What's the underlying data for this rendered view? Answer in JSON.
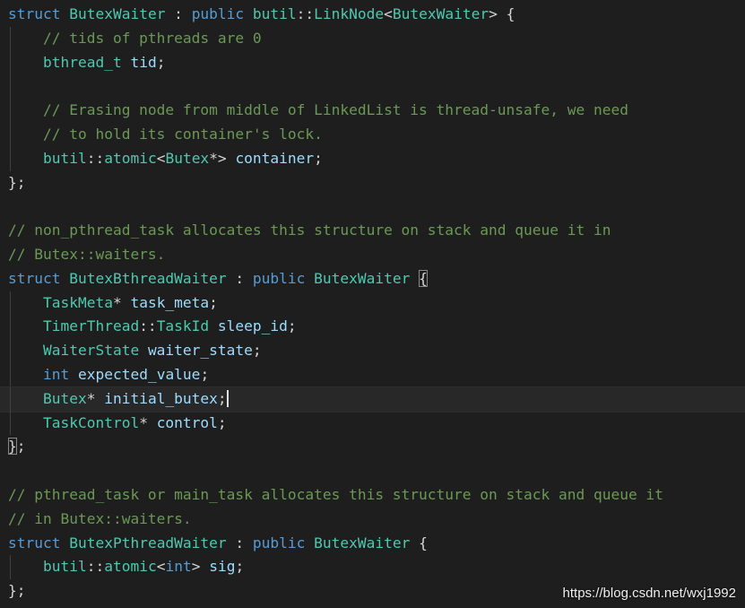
{
  "code_lines": [
    {
      "tokens": [
        {
          "t": "struct ",
          "c": "keyword"
        },
        {
          "t": "ButexWaiter",
          "c": "type"
        },
        {
          "t": " : ",
          "c": "punct"
        },
        {
          "t": "public ",
          "c": "keyword"
        },
        {
          "t": "butil",
          "c": "type"
        },
        {
          "t": "::",
          "c": "punct"
        },
        {
          "t": "LinkNode",
          "c": "type"
        },
        {
          "t": "<",
          "c": "punct"
        },
        {
          "t": "ButexWaiter",
          "c": "type"
        },
        {
          "t": "> {",
          "c": "punct"
        }
      ]
    },
    {
      "guide": true,
      "tokens": [
        {
          "t": "    ",
          "c": "punct"
        },
        {
          "t": "// tids of pthreads are 0",
          "c": "comment"
        }
      ]
    },
    {
      "guide": true,
      "tokens": [
        {
          "t": "    ",
          "c": "punct"
        },
        {
          "t": "bthread_t",
          "c": "type"
        },
        {
          "t": " ",
          "c": "punct"
        },
        {
          "t": "tid",
          "c": "var"
        },
        {
          "t": ";",
          "c": "punct"
        }
      ]
    },
    {
      "guide": true,
      "tokens": []
    },
    {
      "guide": true,
      "tokens": [
        {
          "t": "    ",
          "c": "punct"
        },
        {
          "t": "// Erasing node from middle of LinkedList is thread-unsafe, we need",
          "c": "comment"
        }
      ]
    },
    {
      "guide": true,
      "tokens": [
        {
          "t": "    ",
          "c": "punct"
        },
        {
          "t": "// to hold its container's lock.",
          "c": "comment"
        }
      ]
    },
    {
      "guide": true,
      "tokens": [
        {
          "t": "    ",
          "c": "punct"
        },
        {
          "t": "butil",
          "c": "type"
        },
        {
          "t": "::",
          "c": "punct"
        },
        {
          "t": "atomic",
          "c": "type"
        },
        {
          "t": "<",
          "c": "punct"
        },
        {
          "t": "Butex",
          "c": "type"
        },
        {
          "t": "*> ",
          "c": "punct"
        },
        {
          "t": "container",
          "c": "var"
        },
        {
          "t": ";",
          "c": "punct"
        }
      ]
    },
    {
      "tokens": [
        {
          "t": "};",
          "c": "punct"
        }
      ]
    },
    {
      "tokens": []
    },
    {
      "tokens": [
        {
          "t": "// non_pthread_task allocates this structure on stack and queue it in",
          "c": "comment"
        }
      ]
    },
    {
      "tokens": [
        {
          "t": "// Butex::waiters.",
          "c": "comment"
        }
      ]
    },
    {
      "tokens": [
        {
          "t": "struct ",
          "c": "keyword"
        },
        {
          "t": "ButexBthreadWaiter",
          "c": "type"
        },
        {
          "t": " : ",
          "c": "punct"
        },
        {
          "t": "public ",
          "c": "keyword"
        },
        {
          "t": "ButexWaiter",
          "c": "type"
        },
        {
          "t": " ",
          "c": "punct"
        },
        {
          "t": "{",
          "c": "brace-hl"
        }
      ]
    },
    {
      "guide": true,
      "tokens": [
        {
          "t": "    ",
          "c": "punct"
        },
        {
          "t": "TaskMeta",
          "c": "type"
        },
        {
          "t": "* ",
          "c": "punct"
        },
        {
          "t": "task_meta",
          "c": "var"
        },
        {
          "t": ";",
          "c": "punct"
        }
      ]
    },
    {
      "guide": true,
      "tokens": [
        {
          "t": "    ",
          "c": "punct"
        },
        {
          "t": "TimerThread",
          "c": "type"
        },
        {
          "t": "::",
          "c": "punct"
        },
        {
          "t": "TaskId",
          "c": "type"
        },
        {
          "t": " ",
          "c": "punct"
        },
        {
          "t": "sleep_id",
          "c": "var"
        },
        {
          "t": ";",
          "c": "punct"
        }
      ]
    },
    {
      "guide": true,
      "tokens": [
        {
          "t": "    ",
          "c": "punct"
        },
        {
          "t": "WaiterState",
          "c": "type"
        },
        {
          "t": " ",
          "c": "punct"
        },
        {
          "t": "waiter_state",
          "c": "var"
        },
        {
          "t": ";",
          "c": "punct"
        }
      ]
    },
    {
      "guide": true,
      "tokens": [
        {
          "t": "    ",
          "c": "punct"
        },
        {
          "t": "int",
          "c": "keyword"
        },
        {
          "t": " ",
          "c": "punct"
        },
        {
          "t": "expected_value",
          "c": "var"
        },
        {
          "t": ";",
          "c": "punct"
        }
      ]
    },
    {
      "guide": true,
      "cursor": true,
      "tokens": [
        {
          "t": "    ",
          "c": "punct"
        },
        {
          "t": "Butex",
          "c": "type"
        },
        {
          "t": "* ",
          "c": "punct"
        },
        {
          "t": "initial_butex",
          "c": "var"
        },
        {
          "t": ";",
          "c": "punct"
        }
      ]
    },
    {
      "guide": true,
      "tokens": [
        {
          "t": "    ",
          "c": "punct"
        },
        {
          "t": "TaskControl",
          "c": "type"
        },
        {
          "t": "* ",
          "c": "punct"
        },
        {
          "t": "control",
          "c": "var"
        },
        {
          "t": ";",
          "c": "punct"
        }
      ]
    },
    {
      "tokens": [
        {
          "t": "}",
          "c": "brace-hl"
        },
        {
          "t": ";",
          "c": "punct"
        }
      ]
    },
    {
      "tokens": []
    },
    {
      "tokens": [
        {
          "t": "// pthread_task or main_task allocates this structure on stack and queue it",
          "c": "comment"
        }
      ]
    },
    {
      "tokens": [
        {
          "t": "// in Butex::waiters.",
          "c": "comment"
        }
      ]
    },
    {
      "tokens": [
        {
          "t": "struct ",
          "c": "keyword"
        },
        {
          "t": "ButexPthreadWaiter",
          "c": "type"
        },
        {
          "t": " : ",
          "c": "punct"
        },
        {
          "t": "public ",
          "c": "keyword"
        },
        {
          "t": "ButexWaiter",
          "c": "type"
        },
        {
          "t": " {",
          "c": "punct"
        }
      ]
    },
    {
      "guide": true,
      "tokens": [
        {
          "t": "    ",
          "c": "punct"
        },
        {
          "t": "butil",
          "c": "type"
        },
        {
          "t": "::",
          "c": "punct"
        },
        {
          "t": "atomic",
          "c": "type"
        },
        {
          "t": "<",
          "c": "punct"
        },
        {
          "t": "int",
          "c": "keyword"
        },
        {
          "t": "> ",
          "c": "punct"
        },
        {
          "t": "sig",
          "c": "var"
        },
        {
          "t": ";",
          "c": "punct"
        }
      ]
    },
    {
      "tokens": [
        {
          "t": "};",
          "c": "punct"
        }
      ]
    }
  ],
  "watermark": "https://blog.csdn.net/wxj1992",
  "colors": {
    "background": "#1e1e1e",
    "keyword": "#569cd6",
    "type": "#4ec9b0",
    "variable": "#9cdcfe",
    "comment": "#6a9955"
  }
}
